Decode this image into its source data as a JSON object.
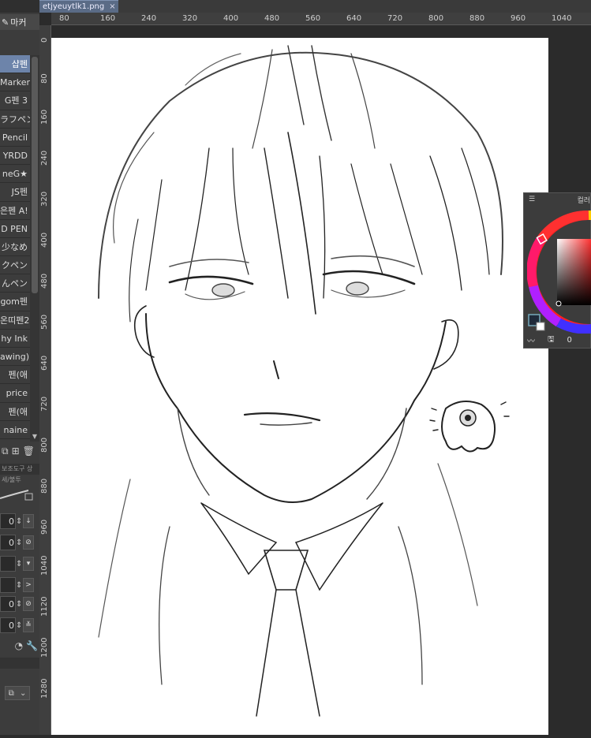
{
  "tab": {
    "filename": "etjyeuytlk1.png",
    "close": "×"
  },
  "brush_panel": {
    "header_label": "마커",
    "items": [
      {
        "label": "샵펜",
        "selected": true
      },
      {
        "label": "Marker",
        "selected": false
      },
      {
        "label": "G펜 3",
        "selected": false
      },
      {
        "label": "ラフペン",
        "selected": false
      },
      {
        "label": "Pencil",
        "selected": false
      },
      {
        "label": "YRDD",
        "selected": false
      },
      {
        "label": "neG★",
        "selected": false
      },
      {
        "label": "JS펜",
        "selected": false
      },
      {
        "label": "은펜 A!",
        "selected": false
      },
      {
        "label": "D PEN",
        "selected": false
      },
      {
        "label": "少なめ",
        "selected": false
      },
      {
        "label": "クペン",
        "selected": false
      },
      {
        "label": "んペン",
        "selected": false
      },
      {
        "label": "gom펜",
        "selected": false
      },
      {
        "label": "온띠펜2",
        "selected": false
      },
      {
        "label": "hy Ink",
        "selected": false
      },
      {
        "label": "awing)",
        "selected": false
      },
      {
        "label": "펜(애",
        "selected": false
      },
      {
        "label": "price",
        "selected": false
      },
      {
        "label": "펜(애",
        "selected": false
      },
      {
        "label": "naine",
        "selected": false
      }
    ],
    "section_label": "보조도구 상세/불투"
  },
  "params": [
    {
      "value": "0",
      "btn": "↓"
    },
    {
      "value": "0",
      "btn": "⊘"
    },
    {
      "value": "",
      "btn": "▾"
    },
    {
      "value": "",
      "btn": ">"
    },
    {
      "value": "0",
      "btn": "⊘"
    },
    {
      "value": "0",
      "btn": "≚"
    }
  ],
  "rulers": {
    "h_labels": [
      "80",
      "160",
      "240",
      "320",
      "400",
      "480",
      "560",
      "640",
      "720",
      "800",
      "880",
      "960",
      "1040"
    ],
    "v_labels": [
      "0",
      "80",
      "160",
      "240",
      "320",
      "400",
      "480",
      "560",
      "640",
      "720",
      "800",
      "880",
      "960",
      "1040",
      "1120",
      "1200",
      "1280"
    ]
  },
  "color_panel": {
    "title": "컬러",
    "readout": "0"
  },
  "colors": {
    "accent_selected": "#6d84aa",
    "panel_bg": "#3c3c3c",
    "canvas": "#ffffff",
    "tab": "#5a6b86"
  }
}
